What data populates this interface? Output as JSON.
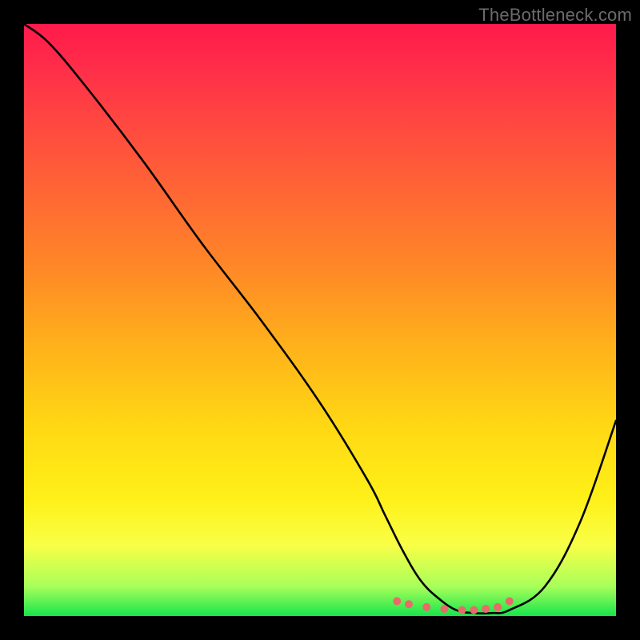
{
  "watermark": "TheBottleneck.com",
  "chart_data": {
    "type": "line",
    "title": "",
    "xlabel": "",
    "ylabel": "",
    "xlim": [
      0,
      100
    ],
    "ylim": [
      0,
      100
    ],
    "series": [
      {
        "name": "bottleneck-curve",
        "x": [
          0,
          4,
          10,
          20,
          30,
          40,
          50,
          58,
          61,
          64,
          67,
          70,
          73,
          76,
          79,
          82,
          88,
          94,
          100
        ],
        "values": [
          100,
          97,
          90,
          77,
          63,
          50,
          36,
          23,
          17,
          11,
          6,
          3,
          1,
          0.5,
          0.5,
          1,
          5,
          16,
          33
        ]
      },
      {
        "name": "optimal-range-markers",
        "x": [
          63,
          65,
          68,
          71,
          74,
          76,
          78,
          80,
          82
        ],
        "values": [
          2.5,
          2.0,
          1.5,
          1.2,
          1.0,
          1.0,
          1.2,
          1.5,
          2.5
        ]
      }
    ],
    "gradient_stops": [
      {
        "pos": 0,
        "color": "#ff1a4b"
      },
      {
        "pos": 8,
        "color": "#ff2f49"
      },
      {
        "pos": 18,
        "color": "#ff4b3f"
      },
      {
        "pos": 30,
        "color": "#ff6a33"
      },
      {
        "pos": 42,
        "color": "#ff8a26"
      },
      {
        "pos": 55,
        "color": "#ffb31a"
      },
      {
        "pos": 68,
        "color": "#ffd814"
      },
      {
        "pos": 80,
        "color": "#fff018"
      },
      {
        "pos": 88,
        "color": "#f9ff46"
      },
      {
        "pos": 95,
        "color": "#a8ff5a"
      },
      {
        "pos": 100,
        "color": "#17e54c"
      }
    ],
    "marker_color": "#e86a6a",
    "curve_color": "#000000"
  }
}
